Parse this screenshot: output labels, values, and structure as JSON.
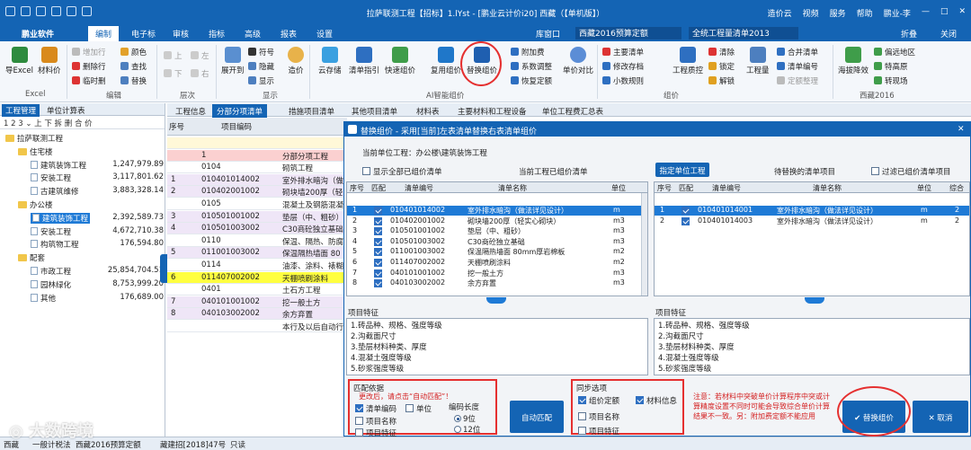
{
  "window": {
    "title": "拉萨联测工程【招标】1.lYst - [鹏业云计价i20] 西藏（【单机版】）",
    "right_items": [
      "造价云",
      "视频",
      "服务",
      "帮助",
      "鹏业-李"
    ]
  },
  "menu": [
    "鹏业软件",
    "编制",
    "电子标",
    "审核",
    "指标",
    "高级",
    "报表",
    "设置"
  ],
  "menu_active_index": 1,
  "menubar_right": {
    "lib_label": "库窗口",
    "lib_value": "西藏2016预算定额",
    "list_value": "全统工程量清单2013",
    "pin": "折叠",
    "close": "关闭"
  },
  "ribbon": {
    "excel": [
      "导Excel",
      "材料价"
    ],
    "excel_group": "Excel",
    "edit_small": [
      "增加行",
      "删除行",
      "临时删"
    ],
    "edit_small2": [
      "颜色",
      "查找",
      "替换"
    ],
    "edit_group": "编辑",
    "level_small": [
      "上",
      "下",
      "左",
      "右"
    ],
    "level_group": "层次",
    "show": [
      "展开到",
      "符号",
      "隐藏",
      "显示"
    ],
    "show_big": "造价",
    "show_group": "显示",
    "ai": [
      "云存储",
      "清单指引",
      "快速组价",
      "复用组价",
      "替换组价",
      "单价对比"
    ],
    "ai_group": "AI智能组价",
    "ai_small": [
      "附加费",
      "系数调整",
      "恢复定额"
    ],
    "zujia_small": [
      "主要清单",
      "修改存档",
      "小数规则"
    ],
    "zujia_group": "组价",
    "zujia_big": [
      "工程质控"
    ],
    "lock_small": [
      "清除",
      "锁定",
      "解锁"
    ],
    "qty": [
      "工程量"
    ],
    "merge_small": [
      "合并清单",
      "清单编号",
      "定额整理"
    ],
    "xz": [
      "海拔降效"
    ],
    "xz_small": [
      "偏远地区",
      "特高原",
      "转现场"
    ],
    "xz_group": "西藏2016"
  },
  "left_panel": {
    "tabs": [
      "工程管理",
      "单位计算表"
    ],
    "tools": "1 2 3  ⌄ 上 下 拆 删 合 价",
    "tree": [
      {
        "label": "拉萨联测工程",
        "value": "",
        "level": 0,
        "type": "folder"
      },
      {
        "label": "住宅楼",
        "value": "",
        "level": 1,
        "type": "folder"
      },
      {
        "label": "建筑装饰工程",
        "value": "1,247,979.89",
        "level": 2,
        "type": "doc"
      },
      {
        "label": "安装工程",
        "value": "3,117,801.62",
        "level": 2,
        "type": "doc"
      },
      {
        "label": "古建筑维修",
        "value": "3,883,328.14",
        "level": 2,
        "type": "doc"
      },
      {
        "label": "办公楼",
        "value": "",
        "level": 1,
        "type": "folder"
      },
      {
        "label": "建筑装饰工程",
        "value": "2,392,589.73",
        "level": 2,
        "type": "doc",
        "selected": true
      },
      {
        "label": "安装工程",
        "value": "4,672,710.38",
        "level": 2,
        "type": "doc"
      },
      {
        "label": "构筑物工程",
        "value": "176,594.80",
        "level": 2,
        "type": "doc"
      },
      {
        "label": "配套",
        "value": "",
        "level": 1,
        "type": "folder"
      },
      {
        "label": "市政工程",
        "value": "25,854,704.51",
        "level": 2,
        "type": "doc"
      },
      {
        "label": "园林绿化",
        "value": "8,753,999.20",
        "level": 2,
        "type": "doc"
      },
      {
        "label": "其他",
        "value": "176,689.00",
        "level": 2,
        "type": "doc"
      }
    ]
  },
  "main_tabs": [
    "工程信息",
    "分部分项清单",
    "措施项目清单",
    "其他项目清单",
    "材料表",
    "主要材料和工程设备",
    "单位工程费汇总表"
  ],
  "main_tab_active": 1,
  "grid": {
    "headers": [
      "序号",
      "项目编码"
    ],
    "rows": [
      {
        "seq": "",
        "code": "",
        "name": "",
        "bg": "#fff8d8"
      },
      {
        "seq": "",
        "code": "1",
        "name": "分部分项工程",
        "bg": "#fbd0d0"
      },
      {
        "seq": "",
        "code": "0104",
        "name": "砌筑工程",
        "bg": "#fff"
      },
      {
        "seq": "1",
        "code": "010401014002",
        "name": "室外排水暗沟（做",
        "bg": "#efe6f7"
      },
      {
        "seq": "2",
        "code": "010402001002",
        "name": "砌块墙200厚（轻",
        "bg": "#efe6f7"
      },
      {
        "seq": "",
        "code": "0105",
        "name": "混凝土及钢筋混凝",
        "bg": "#fff"
      },
      {
        "seq": "3",
        "code": "010501001002",
        "name": "垫层（中、粗砂）",
        "bg": "#efe6f7"
      },
      {
        "seq": "4",
        "code": "010501003002",
        "name": "C30商砼独立基础",
        "bg": "#efe6f7"
      },
      {
        "seq": "",
        "code": "0110",
        "name": "保温、隔热、防腐",
        "bg": "#fff"
      },
      {
        "seq": "5",
        "code": "011001003002",
        "name": "保温隔热墙面 80",
        "bg": "#efe6f7"
      },
      {
        "seq": "",
        "code": "0114",
        "name": "油漆、涂料、裱糊",
        "bg": "#fff"
      },
      {
        "seq": "6",
        "code": "011407002002",
        "name": "天棚喷刷涂料",
        "bg": "#ffff40"
      },
      {
        "seq": "",
        "code": "0401",
        "name": "土石方工程",
        "bg": "#fff"
      },
      {
        "seq": "7",
        "code": "040101001002",
        "name": "挖一般土方",
        "bg": "#efe6f7"
      },
      {
        "seq": "8",
        "code": "040103002002",
        "name": "余方弃置",
        "bg": "#efe6f7"
      },
      {
        "seq": "",
        "code": "",
        "name": "本行及以后自动行",
        "bg": "#fff"
      }
    ]
  },
  "dialog": {
    "title": "替换组价 - 采用[当前]左表清单替换右表清单组价",
    "current_unit_label": "当前单位工程：办公楼\\建筑装饰工程",
    "show_all_label": "显示全部已组价清单",
    "left_header": "当前工程已组价清单",
    "specify_btn": "指定单位工程",
    "right_header": "待替换的清单项目",
    "filter_label": "过滤已组价清单项目",
    "left_cols": [
      "序号",
      "匹配",
      "清单编号",
      "清单名称",
      "单位"
    ],
    "left_rows": [
      {
        "seq": "1",
        "match": true,
        "code": "010401014002",
        "name": "室外排水暗沟（做法详见设计）",
        "unit": "m"
      },
      {
        "seq": "2",
        "match": true,
        "code": "010402001002",
        "name": "砌块墙200厚（轻实心砌块）",
        "unit": "m3"
      },
      {
        "seq": "3",
        "match": true,
        "code": "010501001002",
        "name": "垫层（中、粗砂）",
        "unit": "m3"
      },
      {
        "seq": "4",
        "match": true,
        "code": "010501003002",
        "name": "C30商砼独立基础",
        "unit": "m3"
      },
      {
        "seq": "5",
        "match": true,
        "code": "011001003002",
        "name": "保温隔热墙面 80mm厚岩棉板",
        "unit": "m2"
      },
      {
        "seq": "6",
        "match": true,
        "code": "011407002002",
        "name": "天棚喷刷涂料",
        "unit": "m2"
      },
      {
        "seq": "7",
        "match": true,
        "code": "040101001002",
        "name": "挖一般土方",
        "unit": "m3"
      },
      {
        "seq": "8",
        "match": true,
        "code": "040103002002",
        "name": "余方弃置",
        "unit": "m3"
      }
    ],
    "right_cols": [
      "序号",
      "匹配",
      "清单编号",
      "清单名称",
      "单位",
      "综合"
    ],
    "right_rows": [
      {
        "seq": "1",
        "match": true,
        "code": "010401014001",
        "name": "室外排水暗沟（做法详见设计）",
        "unit": "m",
        "extra": "2"
      },
      {
        "seq": "2",
        "match": true,
        "code": "010401014003",
        "name": "室外排水暗沟（做法详见设计）",
        "unit": "m",
        "extra": "2"
      }
    ],
    "feature_label": "项目特征",
    "left_features": [
      "1.砖品种、规格、强度等级",
      "2.沟截面尺寸",
      "3.垫层材料种类、厚度",
      "4.混凝土强度等级",
      "5.砂浆强度等级"
    ],
    "right_features": [
      "1.砖品种、规格、强度等级",
      "2.沟截面尺寸",
      "3.垫层材料种类、厚度",
      "4.混凝土强度等级",
      "5.砂浆强度等级"
    ],
    "match_basis": {
      "title": "匹配依据",
      "hint": "更改后，请点击“自动匹配”！",
      "options": [
        {
          "label": "清单编码",
          "checked": true
        },
        {
          "label": "单位",
          "checked": false
        },
        {
          "label": "项目名称",
          "checked": false
        },
        {
          "label": "项目特征",
          "checked": false
        }
      ],
      "code_length_label": "编码长度",
      "code_length_options": [
        "9位",
        "12位"
      ],
      "code_length_selected": 0
    },
    "auto_match_btn": "自动匹配",
    "sync": {
      "title": "同步选项",
      "options": [
        {
          "label": "组价定额",
          "checked": true
        },
        {
          "label": "材料信息",
          "checked": true
        },
        {
          "label": "项目名称",
          "checked": false
        },
        {
          "label": "项目特征",
          "checked": false
        }
      ]
    },
    "notice": "注意：若材料中突破单价计算程序中突或计算精度设置不同时可能会导致综合单价计算结果不一致。另：附加费定额不能应用",
    "replace_btn": "替换组价",
    "cancel_btn": "取消"
  },
  "statusbar": [
    "西藏",
    "一般计税法",
    "西藏2016预算定额",
    "藏建招[2018]47号",
    "只读"
  ],
  "watermark": "大数跨境",
  "colors": {
    "primary": "#1464b4",
    "selected": "#1e7ad6",
    "highlight": "#e53030"
  }
}
